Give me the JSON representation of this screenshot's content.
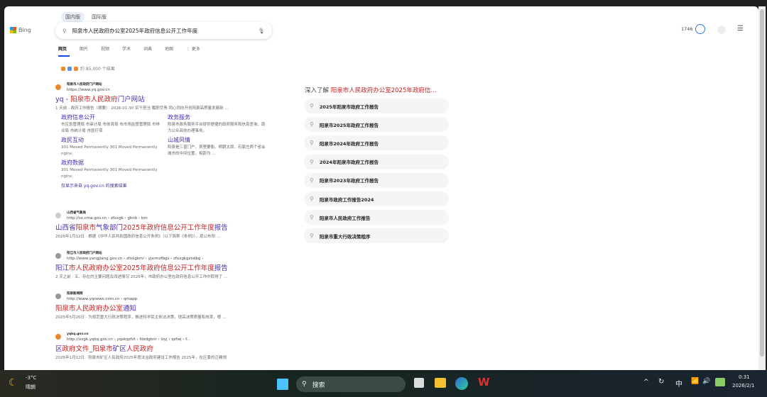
{
  "header": {
    "markets": [
      "国内版",
      "国际版"
    ],
    "brand": "Bing",
    "query": "阳泉市人民政府办公室2025年政府信息公开工作年度",
    "points": "1746",
    "tabs": [
      "网页",
      "图片",
      "视频",
      "学术",
      "词典",
      "地图",
      "⋮ 更多"
    ]
  },
  "results_count": "约 85,000 个结果",
  "results": [
    {
      "site": "阳泉市人民政府门户网站",
      "url": "https://www.yq.gov.cn",
      "title": [
        {
          "t": "yq - ",
          "h": false
        },
        {
          "t": "阳泉市人民政府",
          "h": true
        },
        {
          "t": "门户网站",
          "h": false
        }
      ],
      "snippet": "1 天前 · 政府工作报告（摘要） 2026-01-30 实干担当 履职尽责 同心同向开创阳泉高质量发展新 ...",
      "sublinks": [
        {
          "title": "政府信息公开",
          "desc": "市应急管理局 市审计局 市体育局 市市场监督管理局 市林业局 市统计局 市医疗保"
        },
        {
          "title": "政务服务",
          "desc": "阳泉市政务服务平台提供便捷的政府服务和信息查询，助力公众高效办理事务。"
        },
        {
          "title": "政民互动",
          "desc": "301 Moved Permanently 301 Moved Permanently nginx"
        },
        {
          "title": "山城风情",
          "desc": "阳泉是三晋门户、表里要衡、明朝太原、石家庄两个省会城市的中间位置，相距均 ..."
        },
        {
          "title": "政府数据",
          "desc": "301 Moved Permanently 301 Moved Permanently nginx"
        }
      ],
      "only_from": "仅显示来自 yq.gov.cn 的搜索结果"
    },
    {
      "site": "山西省气象局",
      "url": "http://sx.cma.gov.cn › zfxxgk › gknb › bm",
      "title": [
        {
          "t": "山西省",
          "h": false
        },
        {
          "t": "阳泉市",
          "h": true
        },
        {
          "t": "气象部门",
          "h": false
        },
        {
          "t": "2025年政府信息公开工作年度",
          "h": true
        },
        {
          "t": "报告",
          "h": false
        }
      ],
      "snippet": "2026年1月12日 · 根据《中华人民共和国政府信息公开条例》（以下简称《条例》），现公布阳 ..."
    },
    {
      "site": "阳江市人民政府门户网站",
      "url": "http://www.yangjiang.gov.cn › zfxxgkml › yjsrmzfbgs › zfxxgkgzndbg ›",
      "title": [
        {
          "t": "阳江",
          "h": false
        },
        {
          "t": "市人民政府办公室2025年政府信息公开工作年度",
          "h": true
        },
        {
          "t": "报告",
          "h": false
        }
      ],
      "snippet": "2 天之前 · 五、存在的主要问题及改进情况 2025年，市政府办公室在政府信息公开工作中取得了 ..."
    },
    {
      "site": "阳泉新闻网",
      "url": "http://www.yqnews.com.cn › qmapp",
      "title": [
        {
          "t": "阳泉市人民政府办公室",
          "h": true
        },
        {
          "t": "通知",
          "h": false
        }
      ],
      "snippet": "2025年5月26日 · 为规范重大行政决策程序，推进科学民主依法决策，提高决策质量和效率，根 ..."
    },
    {
      "site": "yqkq.gov.cn",
      "url": "http://xxgk.yqkq.gov.cn › yqskqzfzt › fdzdgknr › lzyj › qzfwj › f...",
      "title": [
        {
          "t": "区",
          "h": false
        },
        {
          "t": "政府文件",
          "h": true
        },
        {
          "t": "_",
          "h": false
        },
        {
          "t": "阳泉市",
          "h": true
        },
        {
          "t": "矿区",
          "h": false
        },
        {
          "t": "人民政府",
          "h": true
        }
      ],
      "snippet": "2026年1月12日 · 阳泉市矿区人民政府2025年度法治政府建设工作报告 2025年，在区委的正确领"
    }
  ],
  "related": {
    "heading_prefix": "深入了解",
    "heading_query": "阳泉市人民政府办公室2025年政府信...",
    "items": [
      "2025年阳泉市政府工作报告",
      "阳泉市2025年政府工作报告",
      "阳泉市2024年政府工作报告",
      "2024年阳泉市政府工作报告",
      "阳泉市2023年政府工作报告",
      "阳泉市政府工作报告2024",
      "阳泉市人民政府工作报告",
      "阳泉市重大行政决策程序"
    ]
  },
  "taskbar": {
    "temp": "-3°C",
    "weather": "晴朗",
    "search": "搜索",
    "ime": "中",
    "time": "0:31",
    "date": "2026/2/1"
  },
  "colors": {
    "link": "#4a2db0",
    "highlight": "#c82020",
    "accent": "#174ae4"
  }
}
